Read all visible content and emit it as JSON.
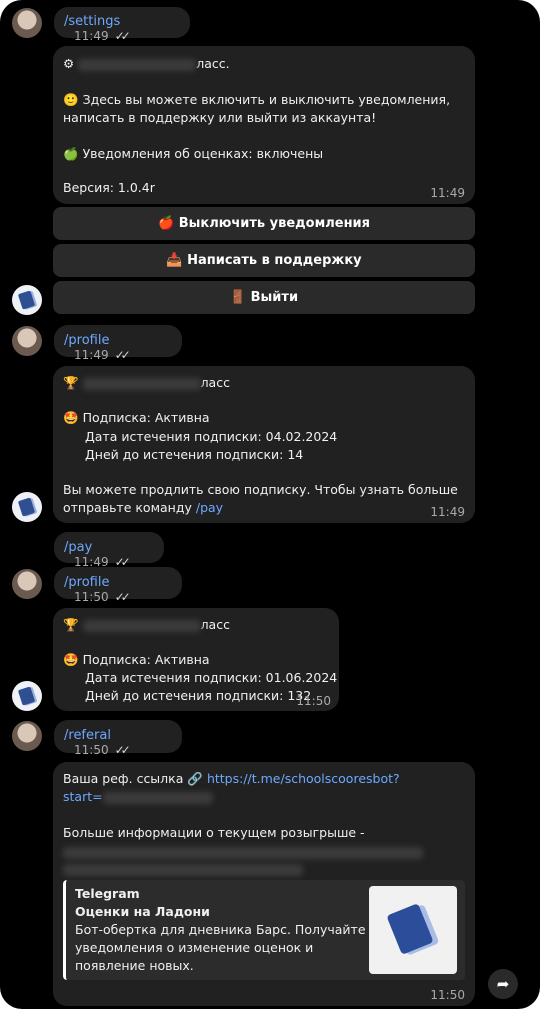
{
  "messages": {
    "settings_cmd": {
      "text": "/settings",
      "time": "11:49",
      "checks": "✓✓"
    },
    "settings_reply": {
      "header_suffix": "ласс.",
      "info": "Здесь вы можете включить и выключить уведомления,",
      "info2": "написать в поддержку или выйти из аккаунта!",
      "notif": "Уведомления об оценках: включены",
      "version": "Версия: 1.0.4r",
      "time": "11:49"
    },
    "buttons": {
      "disable": "Выключить уведомления",
      "support": "Написать в поддержку",
      "logout": "Выйти"
    },
    "profile1_cmd": {
      "text": "/profile",
      "time": "11:49",
      "checks": "✓✓"
    },
    "profile1_reply": {
      "header_suffix": "ласс",
      "subscription": "Подписка: Активна",
      "expiry": "Дата истечения подписки: 04.02.2024",
      "days": "Дней до истечения подписки: 14",
      "renew1": "Вы можете продлить свою подписку. Чтобы узнать больше",
      "renew2": "отправьте команду",
      "renew_cmd": "/pay",
      "time": "11:49"
    },
    "pay_cmd": {
      "text": "/pay",
      "time": "11:49",
      "checks": "✓✓"
    },
    "profile2_cmd": {
      "text": "/profile",
      "time": "11:50",
      "checks": "✓✓"
    },
    "profile2_reply": {
      "header_suffix": "ласс",
      "subscription": "Подписка: Активна",
      "expiry": "Дата истечения подписки: 01.06.2024",
      "days": "Дней до истечения подписки: 132",
      "time": "11:50"
    },
    "referal_cmd": {
      "text": "/referal",
      "time": "11:50",
      "checks": "✓✓"
    },
    "referal_reply": {
      "ref_label": "Ваша реф. ссылка",
      "ref_link": "https://t.me/schoolscooresbot?",
      "ref_link2": "start=",
      "more_info": "Больше информации о текущем розыгрыше -",
      "preview_site": "Telegram",
      "preview_title": "Оценки на Ладони",
      "preview_desc1": "Бот-обертка для дневника Барс. Получайте",
      "preview_desc2": "уведомления о изменение оценок и",
      "preview_desc3": "появление новых.",
      "time": "11:50"
    }
  },
  "icons": {
    "gear": "⚙",
    "smile": "🙂",
    "apple_green": "🍏",
    "apple_red": "🍎",
    "inbox": "📥",
    "door": "🚪",
    "trophy": "🏆",
    "star_face": "🤩",
    "link": "🔗",
    "share": "➦"
  }
}
